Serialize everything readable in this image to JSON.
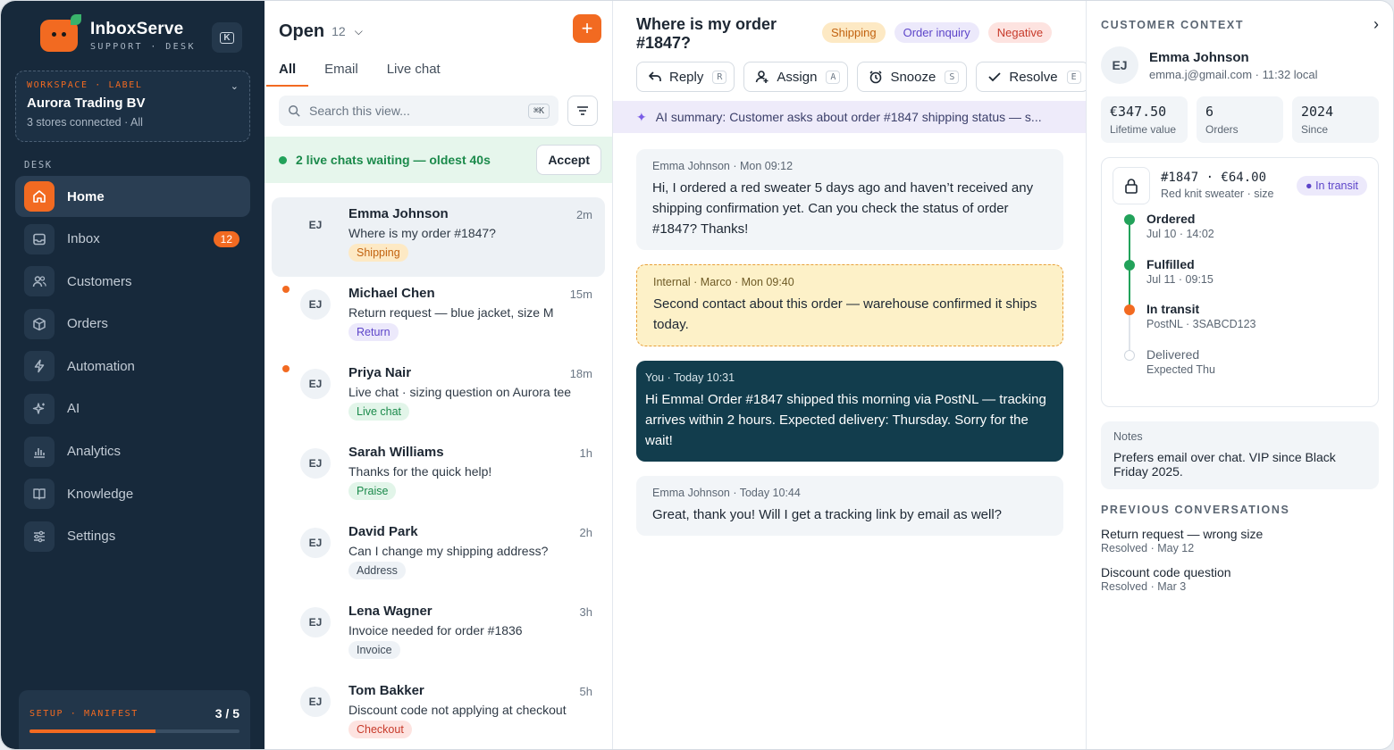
{
  "brand": {
    "name": "InboxServe",
    "sub": "SUPPORT · DESK",
    "collapse_key": "K"
  },
  "workspace": {
    "label": "WORKSPACE · LABEL",
    "name": "Aurora Trading BV",
    "meta": "3 stores connected · All"
  },
  "sidebar": {
    "section": "DESK",
    "items": [
      {
        "label": "Home",
        "icon": "home-icon"
      },
      {
        "label": "Inbox",
        "icon": "inbox-icon",
        "badge": "12"
      },
      {
        "label": "Customers",
        "icon": "users-icon"
      },
      {
        "label": "Orders",
        "icon": "box-icon"
      },
      {
        "label": "Automation",
        "icon": "bolt-icon"
      },
      {
        "label": "AI",
        "icon": "sparkle-icon"
      },
      {
        "label": "Analytics",
        "icon": "chart-icon"
      },
      {
        "label": "Knowledge",
        "icon": "book-icon"
      },
      {
        "label": "Settings",
        "icon": "sliders-icon"
      }
    ],
    "setup": {
      "label": "SETUP · MANIFEST",
      "count": "3 / 5",
      "progress": 0.6
    }
  },
  "list": {
    "title": "Open",
    "count": "12",
    "add": "+",
    "tabs": [
      "All",
      "Email",
      "Live chat"
    ],
    "search_placeholder": "Search this view...",
    "search_kbd": "⌘K",
    "live": {
      "text": "2 live chats waiting — oldest 40s",
      "accept": "Accept"
    },
    "conversations": [
      {
        "initials": "EJ",
        "name": "Emma Johnson",
        "time": "2m",
        "preview": "Where is my order #1847?",
        "tag": "Shipping",
        "tag_bg": "#fde9c4",
        "tag_fg": "#c2620f",
        "unread": false,
        "selected": true
      },
      {
        "initials": "EJ",
        "name": "Michael Chen",
        "time": "15m",
        "preview": "Return request — blue jacket, size M",
        "tag": "Return",
        "tag_bg": "#ece9fb",
        "tag_fg": "#5d45c9",
        "unread": true,
        "selected": false
      },
      {
        "initials": "EJ",
        "name": "Priya Nair",
        "time": "18m",
        "preview": "Live chat · sizing question on Aurora tee",
        "tag": "Live chat",
        "tag_bg": "#e2f5e9",
        "tag_fg": "#1b8a4b",
        "unread": true,
        "selected": false
      },
      {
        "initials": "EJ",
        "name": "Sarah Williams",
        "time": "1h",
        "preview": "Thanks for the quick help!",
        "tag": "Praise",
        "tag_bg": "#e2f5e9",
        "tag_fg": "#1b8a4b",
        "unread": false,
        "selected": false
      },
      {
        "initials": "EJ",
        "name": "David Park",
        "time": "2h",
        "preview": "Can I change my shipping address?",
        "tag": "Address",
        "tag_bg": "#eef2f6",
        "tag_fg": "#3e4a57",
        "unread": false,
        "selected": false
      },
      {
        "initials": "EJ",
        "name": "Lena Wagner",
        "time": "3h",
        "preview": "Invoice needed for order #1836",
        "tag": "Invoice",
        "tag_bg": "#eef2f6",
        "tag_fg": "#3e4a57",
        "unread": false,
        "selected": false
      },
      {
        "initials": "EJ",
        "name": "Tom Bakker",
        "time": "5h",
        "preview": "Discount code not applying at checkout",
        "tag": "Checkout",
        "tag_bg": "#fde3e0",
        "tag_fg": "#c73a2a",
        "unread": false,
        "selected": false
      }
    ]
  },
  "thread": {
    "title": "Where is my order #1847?",
    "tags": [
      {
        "label": "Shipping",
        "bg": "#fde9c4",
        "fg": "#c2620f"
      },
      {
        "label": "Order inquiry",
        "bg": "#ece9fb",
        "fg": "#5d45c9"
      },
      {
        "label": "Negative",
        "bg": "#fde3e0",
        "fg": "#c73a2a"
      }
    ],
    "actions": [
      {
        "label": "Reply",
        "key": "R",
        "icon": "reply-icon"
      },
      {
        "label": "Assign",
        "key": "A",
        "icon": "assign-icon"
      },
      {
        "label": "Snooze",
        "key": "S",
        "icon": "snooze-icon"
      },
      {
        "label": "Resolve",
        "key": "E",
        "icon": "check-icon"
      }
    ],
    "ai_summary": "AI summary: Customer asks about order #1847 shipping status — s...",
    "messages": [
      {
        "kind": "customer",
        "meta": "Emma Johnson · Mon 09:12",
        "body": "Hi, I ordered a red sweater 5 days ago and haven’t received any shipping confirmation yet. Can you check the status of order #1847? Thanks!"
      },
      {
        "kind": "internal",
        "meta": "Internal · Marco · Mon 09:40",
        "body": "Second contact about this order — warehouse confirmed it ships today."
      },
      {
        "kind": "agent",
        "meta": "You · Today 10:31",
        "body": "Hi Emma! Order #1847 shipped this morning via PostNL — tracking arrives within 2 hours. Expected delivery: Thursday. Sorry for the wait!"
      },
      {
        "kind": "customer",
        "meta": "Emma Johnson · Today 10:44",
        "body": "Great, thank you! Will I get a tracking link by email as well?"
      }
    ]
  },
  "context": {
    "label": "CUSTOMER CONTEXT",
    "customer": {
      "initials": "EJ",
      "name": "Emma Johnson",
      "meta": "emma.j@gmail.com · 11:32 local"
    },
    "stats": [
      {
        "value": "€347.50",
        "label": "Lifetime value"
      },
      {
        "value": "6",
        "label": "Orders"
      },
      {
        "value": "2024",
        "label": "Since"
      }
    ],
    "order": {
      "id": "#1847 · €64.00",
      "item": "Red knit sweater · size M",
      "status": "In transit",
      "steps": [
        {
          "name": "Ordered",
          "sub": "Jul 10 · 14:02",
          "state": "done"
        },
        {
          "name": "Fulfilled",
          "sub": "Jul 11 · 09:15",
          "state": "done"
        },
        {
          "name": "In transit",
          "sub": "PostNL · 3SABCD123",
          "state": "current"
        },
        {
          "name": "Delivered",
          "sub": "Expected Thu",
          "state": "pending"
        }
      ]
    },
    "notes": {
      "label": "Notes",
      "body": "Prefers email over chat. VIP since Black Friday 2025."
    },
    "previous_label": "PREVIOUS CONVERSATIONS",
    "previous": [
      {
        "title": "Return request — wrong size",
        "sub": "Resolved · May 12"
      },
      {
        "title": "Discount code question",
        "sub": "Resolved · Mar 3"
      }
    ]
  }
}
